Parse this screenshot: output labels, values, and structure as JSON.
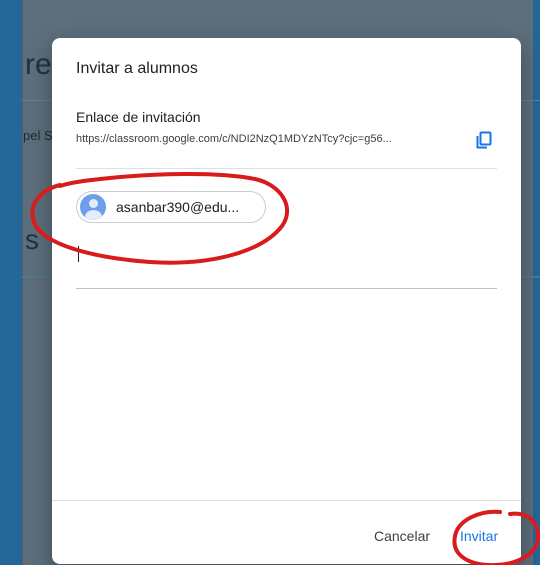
{
  "background": {
    "title_fragment": "re",
    "subtitle_fragment": "pel S",
    "heading_fragment": "s"
  },
  "dialog": {
    "title": "Invitar a alumnos",
    "invite_link_label": "Enlace de invitación",
    "invite_link_url": "https://classroom.google.com/c/NDI2NzQ1MDYzNTcy?cjc=g56...",
    "copy_icon": "copy-icon",
    "recipient_chip_text": "asanbar390@edu...",
    "cancel_label": "Cancelar",
    "invite_label": "Invitar"
  },
  "colors": {
    "accent": "#1a73e8",
    "annotation": "#d81b1b",
    "dialog_bg": "#ffffff",
    "backdrop": "#26679a"
  }
}
